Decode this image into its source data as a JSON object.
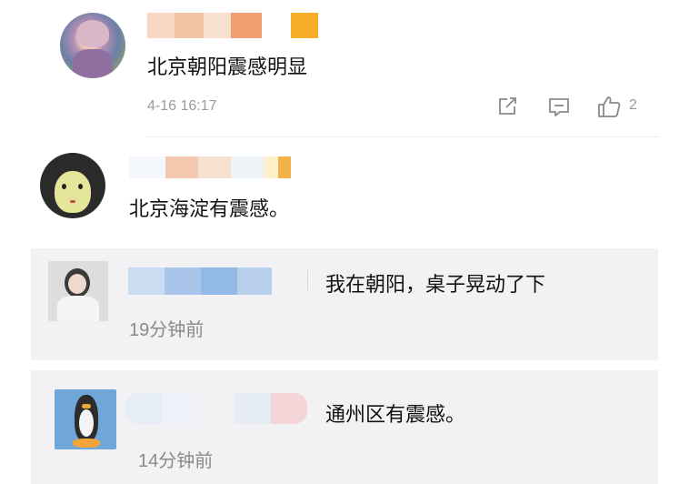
{
  "comment1": {
    "text": "北京朝阳震感明显",
    "time": "4-16 16:17",
    "like_count": "2",
    "share_icon": "share-icon",
    "reply_icon": "comment-icon",
    "like_icon": "thumbs-up-icon"
  },
  "comment2": {
    "text": "北京海淀有震感。"
  },
  "reply1": {
    "text": "我在朝阳，桌子晃动了下",
    "time": "19分钟前"
  },
  "reply2": {
    "text": "通州区有震感。",
    "time": "14分钟前"
  }
}
